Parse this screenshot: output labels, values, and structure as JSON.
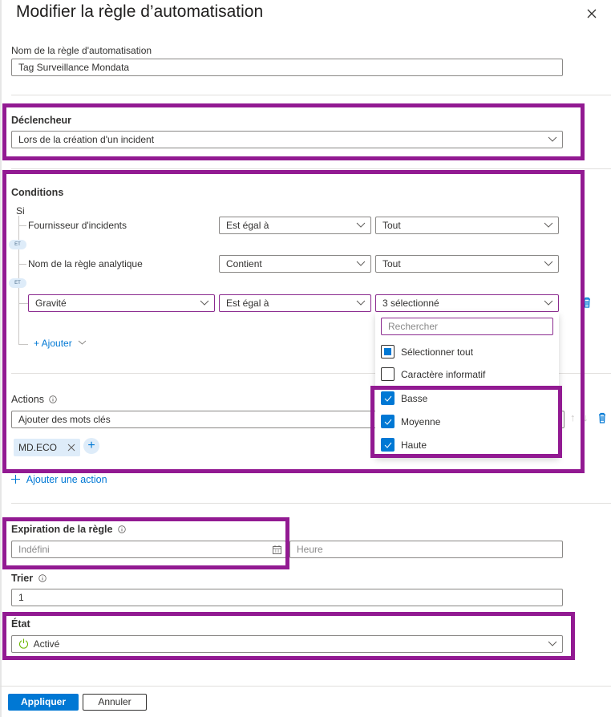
{
  "header": {
    "title": "Modifier la règle d’automatisation",
    "close_icon": "close-icon"
  },
  "rule_name": {
    "label": "Nom de la règle d'automatisation",
    "value": "Tag Surveillance Mondata"
  },
  "trigger": {
    "label": "Déclencheur",
    "value": "Lors de la création d'un incident"
  },
  "conditions": {
    "label": "Conditions",
    "if_label": "Si",
    "and_label": "ET",
    "rows": [
      {
        "property": "Fournisseur d'incidents",
        "operator": "Est égal à",
        "value": "Tout"
      },
      {
        "property": "Nom de la règle analytique",
        "operator": "Contient",
        "value": "Tout"
      },
      {
        "property": "Gravité",
        "operator": "Est égal à",
        "value": "3 sélectionné"
      }
    ],
    "add_label": "+ Ajouter",
    "dropdown": {
      "search_placeholder": "Rechercher",
      "options": [
        {
          "label": "Sélectionner tout",
          "state": "indeterminate"
        },
        {
          "label": "Caractère informatif",
          "state": "unchecked"
        },
        {
          "label": "Basse",
          "state": "checked"
        },
        {
          "label": "Moyenne",
          "state": "checked"
        },
        {
          "label": "Haute",
          "state": "checked"
        }
      ]
    }
  },
  "actions": {
    "label": "Actions",
    "value": "Ajouter des mots clés",
    "tags": [
      "MD.ECO"
    ],
    "add_action_label": "Ajouter une action"
  },
  "expiration": {
    "label": "Expiration de la règle",
    "date_placeholder": "Indéfini",
    "time_placeholder": "Heure"
  },
  "order": {
    "label": "Trier",
    "value": "1"
  },
  "status": {
    "label": "État",
    "value": "Activé"
  },
  "footer": {
    "apply_label": "Appliquer",
    "cancel_label": "Annuler"
  },
  "colors": {
    "accent": "#0078d4",
    "highlight": "#921a92",
    "status_on": "#6bb700"
  }
}
